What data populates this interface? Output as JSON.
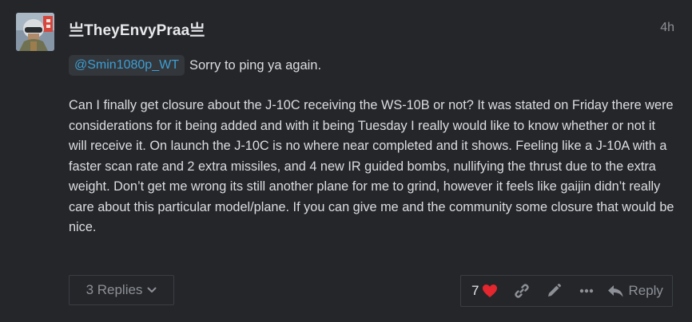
{
  "post": {
    "username": "亗TheyEnvyPraa亗",
    "age": "4h",
    "mention": "@Smin1080p_WT",
    "mention_text": "Sorry to ping ya again.",
    "body": "Can I finally get closure about the J-10C receiving the WS-10B or not? It was stated on Friday there were considerations for it being added and with it being Tuesday I really would like to know whether or not it will receive it. On launch the J-10C is no where near completed and it shows. Feeling like a J-10A with a faster scan rate and 2 extra missiles, and 4 new IR guided bombs, nullifying the thrust due to the extra weight. Don’t get me wrong its still another plane for me to grind, however it feels like gaijin didn’t really care about this particular model/plane. If you can give me and the community some closure that would be nice."
  },
  "footer": {
    "replies_label": "3 Replies",
    "like_count": "7",
    "reply_label": "Reply"
  },
  "colors": {
    "background": "#24262a",
    "mention": "#3d9fd4",
    "like_heart": "#e4262e",
    "muted": "#8d9096"
  },
  "icons": {
    "avatar": "avatar-image",
    "replies_toggle": "chevron-down-icon",
    "like": "heart-icon",
    "copy_link": "link-icon",
    "edit": "pencil-icon",
    "more": "ellipsis-icon",
    "reply": "reply-arrow-icon"
  }
}
